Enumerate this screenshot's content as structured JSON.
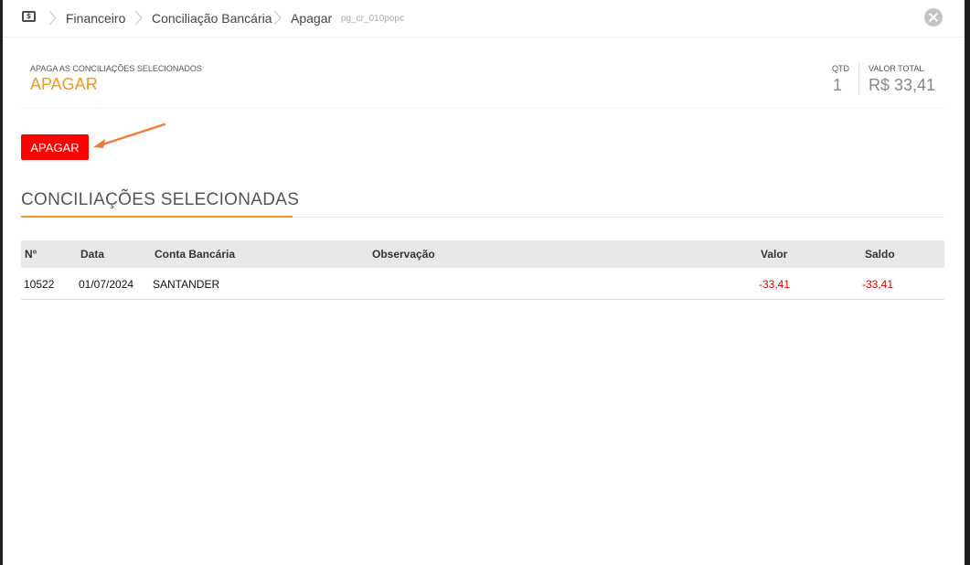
{
  "breadcrumb": {
    "items": [
      "Financeiro",
      "Conciliação Bancária",
      "Apagar"
    ],
    "page_code": "pg_cr_010popc",
    "home_icon": "money-icon"
  },
  "header": {
    "subtitle": "APAGA AS CONCILIAÇÕES SELECIONADOS",
    "title": "APAGAR",
    "qtd_label": "QTD",
    "qtd_value": "1",
    "total_label": "VALOR TOTAL",
    "total_value": "R$ 33,41"
  },
  "actions": {
    "apagar_label": "APAGAR"
  },
  "section": {
    "title": "CONCILIAÇÕES SELECIONADAS"
  },
  "table": {
    "columns": [
      "N°",
      "Data",
      "Conta Bancária",
      "Observação",
      "Valor",
      "Saldo"
    ],
    "rows": [
      [
        "10522",
        "01/07/2024",
        "SANTANDER",
        "",
        "-33,41",
        "-33,41"
      ]
    ]
  },
  "colors": {
    "accent": "#f79520",
    "danger": "#ff0000",
    "negative": "#e00000"
  }
}
